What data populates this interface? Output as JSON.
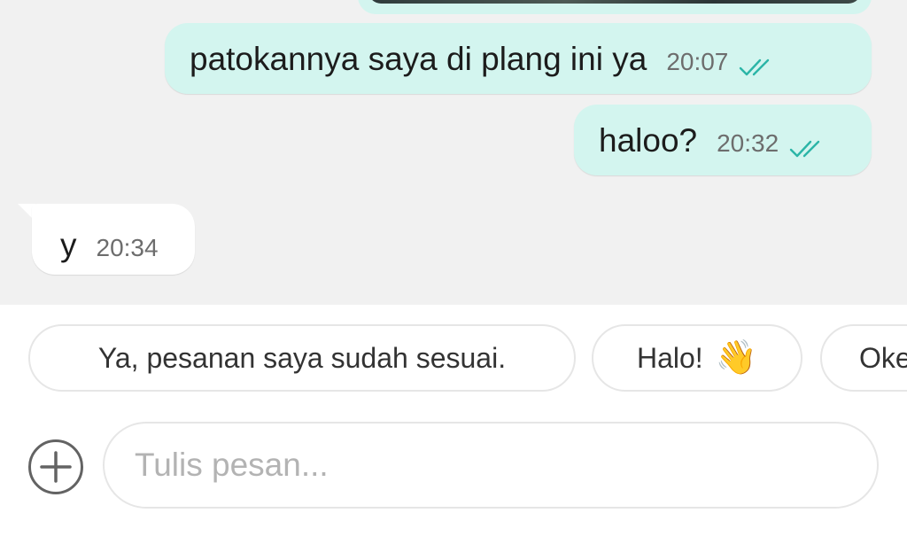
{
  "messages": [
    {
      "direction": "outgoing",
      "text": "patokannya saya di plang ini ya",
      "time": "20:07",
      "status_icon": "double-check-icon"
    },
    {
      "direction": "outgoing",
      "text": "haloo?",
      "time": "20:32",
      "status_icon": "double-check-icon"
    },
    {
      "direction": "incoming",
      "text": "y",
      "time": "20:34"
    }
  ],
  "quick_replies": [
    {
      "label": "Ya, pesanan saya sudah sesuai."
    },
    {
      "label": "Halo!",
      "emoji": "👋"
    },
    {
      "label": "Oke"
    }
  ],
  "composer": {
    "placeholder": "Tulis pesan...",
    "value": "",
    "add_icon": "plus-circle-icon"
  },
  "colors": {
    "chat_background": "#f1f1f1",
    "outgoing_bubble": "#d3f5ef",
    "incoming_bubble": "#ffffff",
    "read_ticks": "#2bb5a7"
  }
}
